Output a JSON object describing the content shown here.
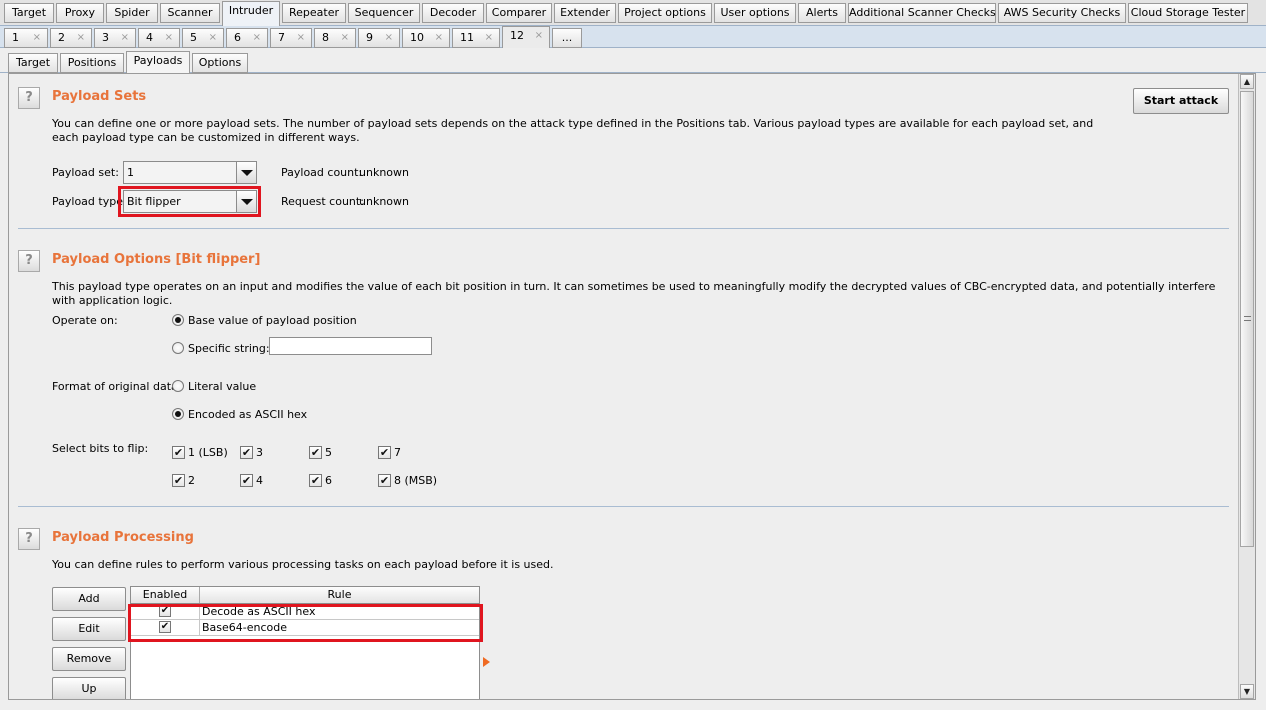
{
  "main_tabs": [
    "Target",
    "Proxy",
    "Spider",
    "Scanner",
    "Intruder",
    "Repeater",
    "Sequencer",
    "Decoder",
    "Comparer",
    "Extender",
    "Project options",
    "User options",
    "Alerts",
    "Additional Scanner Checks",
    "AWS Security Checks",
    "Cloud Storage Tester"
  ],
  "main_active": "Intruder",
  "number_tabs": [
    "1",
    "2",
    "3",
    "4",
    "5",
    "6",
    "7",
    "8",
    "9",
    "10",
    "11",
    "12",
    "..."
  ],
  "number_active": "12",
  "close_glyph": "×",
  "sub_tabs": [
    "Target",
    "Positions",
    "Payloads",
    "Options"
  ],
  "sub_active": "Payloads",
  "help_glyph": "?",
  "start_attack": "Start attack",
  "payload_sets": {
    "heading": "Payload Sets",
    "description": "You can define one or more payload sets. The number of payload sets depends on the attack type defined in the Positions tab. Various payload types are available for each payload set, and each payload type can be customized in different ways.",
    "set_label": "Payload set:",
    "set_value": "1",
    "type_label": "Payload type:",
    "type_value": "Bit flipper",
    "count_label": "Payload count:",
    "count_value": "unknown",
    "request_label": "Request count:",
    "request_value": "unknown"
  },
  "payload_options": {
    "heading": "Payload Options [Bit flipper]",
    "description": "This payload type operates on an input and modifies the value of each bit position in turn. It can sometimes be used to meaningfully modify the decrypted values of CBC-encrypted data, and potentially interfere with application logic.",
    "operate_label": "Operate on:",
    "operate_base": "Base value of payload position",
    "operate_specific": "Specific string:",
    "specific_value": "",
    "format_label": "Format of original data:",
    "format_literal": "Literal value",
    "format_hex": "Encoded as ASCII hex",
    "bits_label": "Select bits to flip:",
    "bits": [
      "1 (LSB)",
      "3",
      "5",
      "7",
      "2",
      "4",
      "6",
      "8 (MSB)"
    ]
  },
  "payload_processing": {
    "heading": "Payload Processing",
    "description": "You can define rules to perform various processing tasks on each payload before it is used.",
    "buttons": [
      "Add",
      "Edit",
      "Remove",
      "Up"
    ],
    "columns": [
      "Enabled",
      "Rule"
    ],
    "rows": [
      {
        "enabled": true,
        "rule": "Decode as ASCII hex"
      },
      {
        "enabled": true,
        "rule": "Base64-encode"
      }
    ]
  },
  "check_glyph": "✔",
  "scroll_up_glyph": "▲",
  "scroll_down_glyph": "▼",
  "colors": {
    "accent": "#e8743b",
    "highlight": "#e0151f",
    "divider": "#a9bcd2"
  }
}
